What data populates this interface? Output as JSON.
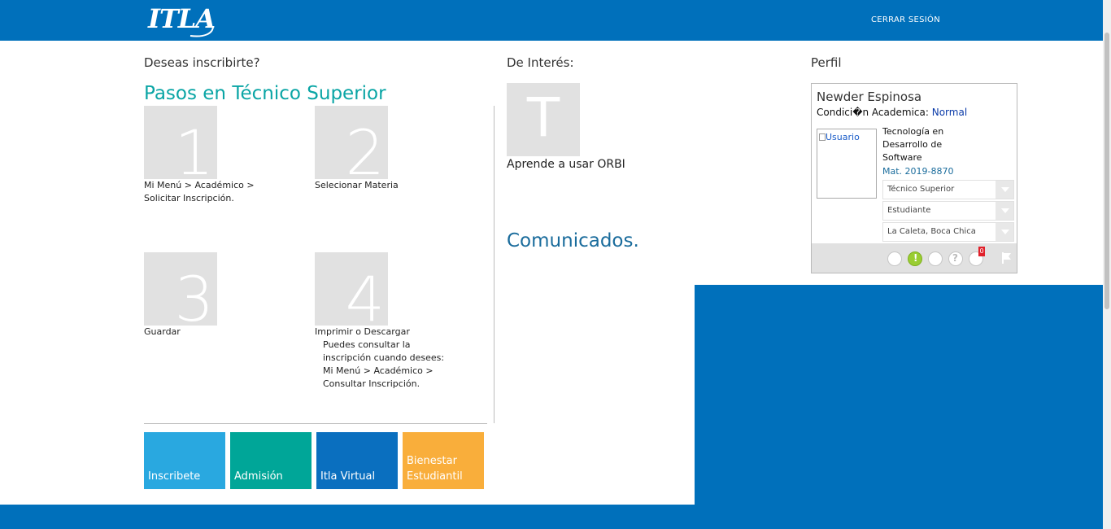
{
  "header": {
    "logo_text": "ITLA",
    "logout_label": "CERRAR SESIÓN"
  },
  "steps_section": {
    "heading": "Deseas inscribirte?",
    "title_prefix": "Pasos en",
    "title_program": "Técnico Superior",
    "steps": [
      {
        "number": "1",
        "text_line1": "Mi Menú > Académico >",
        "text_line2": "Solicitar Inscripción."
      },
      {
        "number": "2",
        "text_line1": "Selecionar Materia"
      },
      {
        "number": "3",
        "text_line1": "Guardar"
      },
      {
        "number": "4",
        "text_line1": "Imprimir o Descargar",
        "note_line1": "Puedes consultar la",
        "note_line2": "inscripción cuando desees:",
        "note_line3": "Mi Menú > Académico >",
        "note_line4": "Consultar Inscripción."
      }
    ]
  },
  "tiles": [
    {
      "label": "Inscribete",
      "color": "#29a8e0"
    },
    {
      "label": "Admisión",
      "color": "#00a698"
    },
    {
      "label": "Itla Virtual",
      "color": "#0a6fbf"
    },
    {
      "label_line1": "Bienestar",
      "label_line2": "Estudiantil",
      "color": "#f9ae3b"
    }
  ],
  "interest": {
    "heading": "De Interés:",
    "item_letter": "T",
    "item_label": "Aprende a usar ORBI",
    "news_title": "Comunicados."
  },
  "profile": {
    "heading": "Perfil",
    "name": "Newder Espinosa",
    "condition_label": "Condici�n Academica:",
    "condition_value": "Normal",
    "photo_alt": "Usuario",
    "career_line1": "Tecnología en",
    "career_line2": "Desarrollo de",
    "career_line3": "Software",
    "matricula": "Mat. 2019-8870",
    "level_select": "Técnico Superior",
    "role_select": "Estudiante",
    "campus_select": "La Caleta, Boca Chica",
    "notification_count": "0"
  },
  "colors": {
    "brand_blue": "#0070bb",
    "teal": "#0aa5a5",
    "step_gray": "#e1e1e1"
  }
}
